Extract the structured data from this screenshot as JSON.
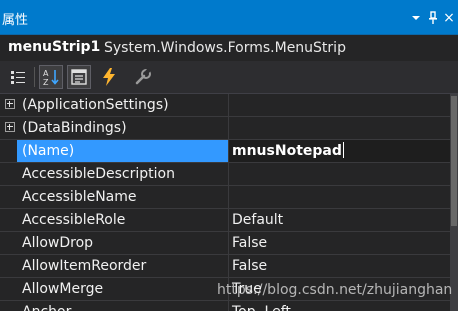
{
  "colors": {
    "title_bar": "#007acc",
    "panel_background": "#252526",
    "selection": "#3399ff",
    "text": "#f1f1f1"
  },
  "panel": {
    "title": "属性",
    "dropdown_icon": "chevron-down-icon",
    "pin_icon": "pin-icon",
    "close_icon": "close-icon",
    "close_glyph": "×"
  },
  "object_selector": {
    "name": "menuStrip1",
    "type": "System.Windows.Forms.MenuStrip"
  },
  "toolbar": {
    "buttons": [
      {
        "icon": "categorized-icon",
        "active": false
      },
      {
        "icon": "alphabetical-icon",
        "active": true
      },
      {
        "icon": "properties-icon",
        "active": true
      },
      {
        "icon": "events-lightning-icon",
        "active": false
      },
      {
        "icon": "property-pages-wrench-icon",
        "active": false
      }
    ]
  },
  "properties": [
    {
      "name": "(ApplicationSettings)",
      "value": "",
      "expandable": true
    },
    {
      "name": "(DataBindings)",
      "value": "",
      "expandable": true
    },
    {
      "name": "(Name)",
      "value": "mnusNotepad",
      "selected": true,
      "editing": true
    },
    {
      "name": "AccessibleDescription",
      "value": ""
    },
    {
      "name": "AccessibleName",
      "value": ""
    },
    {
      "name": "AccessibleRole",
      "value": "Default"
    },
    {
      "name": "AllowDrop",
      "value": "False"
    },
    {
      "name": "AllowItemReorder",
      "value": "False"
    },
    {
      "name": "AllowMerge",
      "value": "True"
    },
    {
      "name": "Anchor",
      "value": "Top, Left"
    }
  ],
  "watermark": "https://blog.csdn.net/zhujianghan"
}
